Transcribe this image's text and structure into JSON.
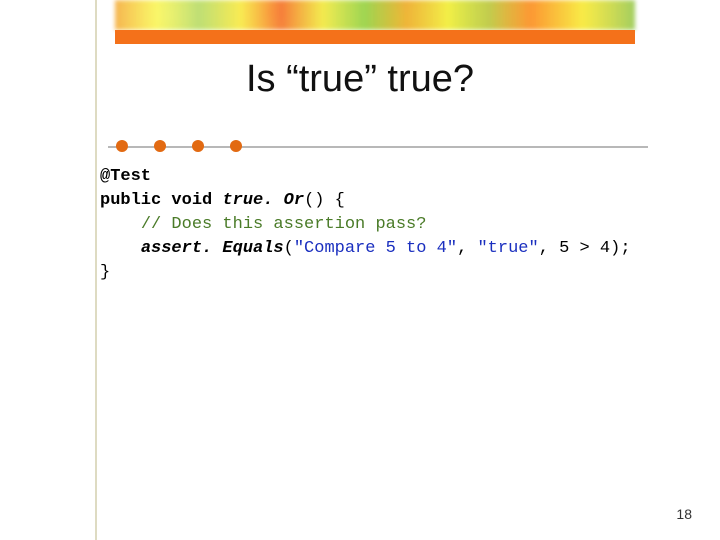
{
  "title": "Is “true” true?",
  "code": {
    "annotation": "@Test",
    "kw_public": "public",
    "kw_void": "void",
    "fn_name": "true. Or",
    "sig_after": "() {",
    "comment": "// Does this assertion pass?",
    "call_name": "assert. Equals",
    "str1": "\"Compare 5 to 4\"",
    "comma1": ", ",
    "str2": "\"true\"",
    "tail": ", 5 > 4);",
    "close": "}"
  },
  "page_number": "18"
}
